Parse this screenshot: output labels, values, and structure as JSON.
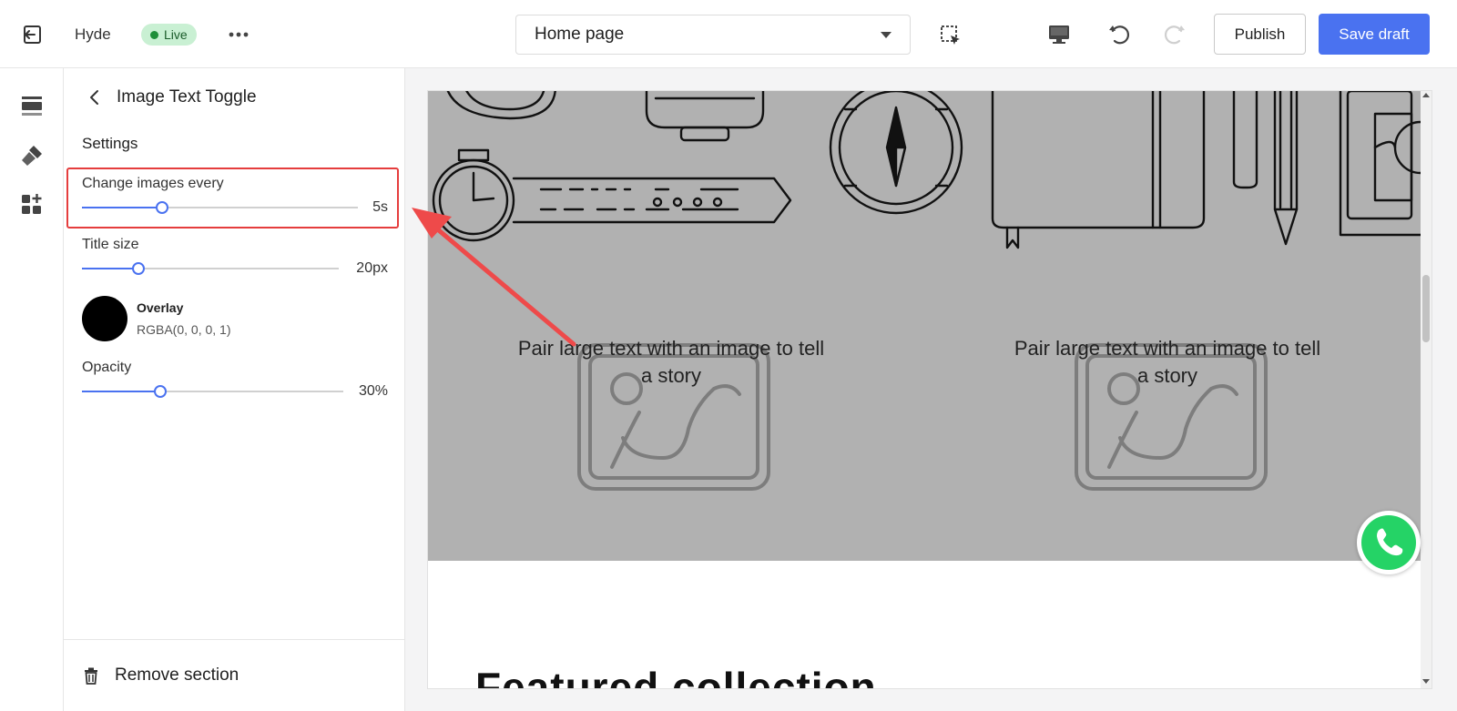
{
  "topbar": {
    "store_name": "Hyde",
    "status_badge": "Live",
    "page_selector": "Home page",
    "publish_label": "Publish",
    "save_label": "Save draft"
  },
  "panel": {
    "title": "Image Text Toggle",
    "section_label": "Settings",
    "fields": [
      {
        "label": "Change images every",
        "value_text": "5s",
        "fraction": 0.29
      },
      {
        "label": "Title size",
        "value_text": "20px",
        "fraction": 0.22
      },
      {
        "label": "Opacity",
        "value_text": "30%",
        "fraction": 0.3
      }
    ],
    "overlay": {
      "name": "Overlay",
      "value": "RGBA(0, 0, 0, 1)",
      "color": "#000000"
    },
    "remove_label": "Remove section"
  },
  "preview": {
    "story_left": "Pair large text with an image to tell a story",
    "story_right": "Pair large text with an image to tell a story",
    "heading_peek": "Featured collection"
  },
  "colors": {
    "accent": "#4a72f0",
    "live_badge": "#c9f0d3",
    "highlight": "#e53d3d",
    "hero_bg": "#b1b1b1",
    "whatsapp": "#25d366"
  },
  "icons": {
    "exit": "exit-icon",
    "more": "more-icon",
    "select": "select-element-icon",
    "desktop": "desktop-icon",
    "undo": "undo-icon",
    "redo": "redo-icon",
    "sections": "sections-icon",
    "theme": "theme-settings-icon",
    "apps": "apps-icon",
    "back": "back-chevron-icon",
    "trash": "trash-icon",
    "whatsapp": "whatsapp-icon"
  }
}
